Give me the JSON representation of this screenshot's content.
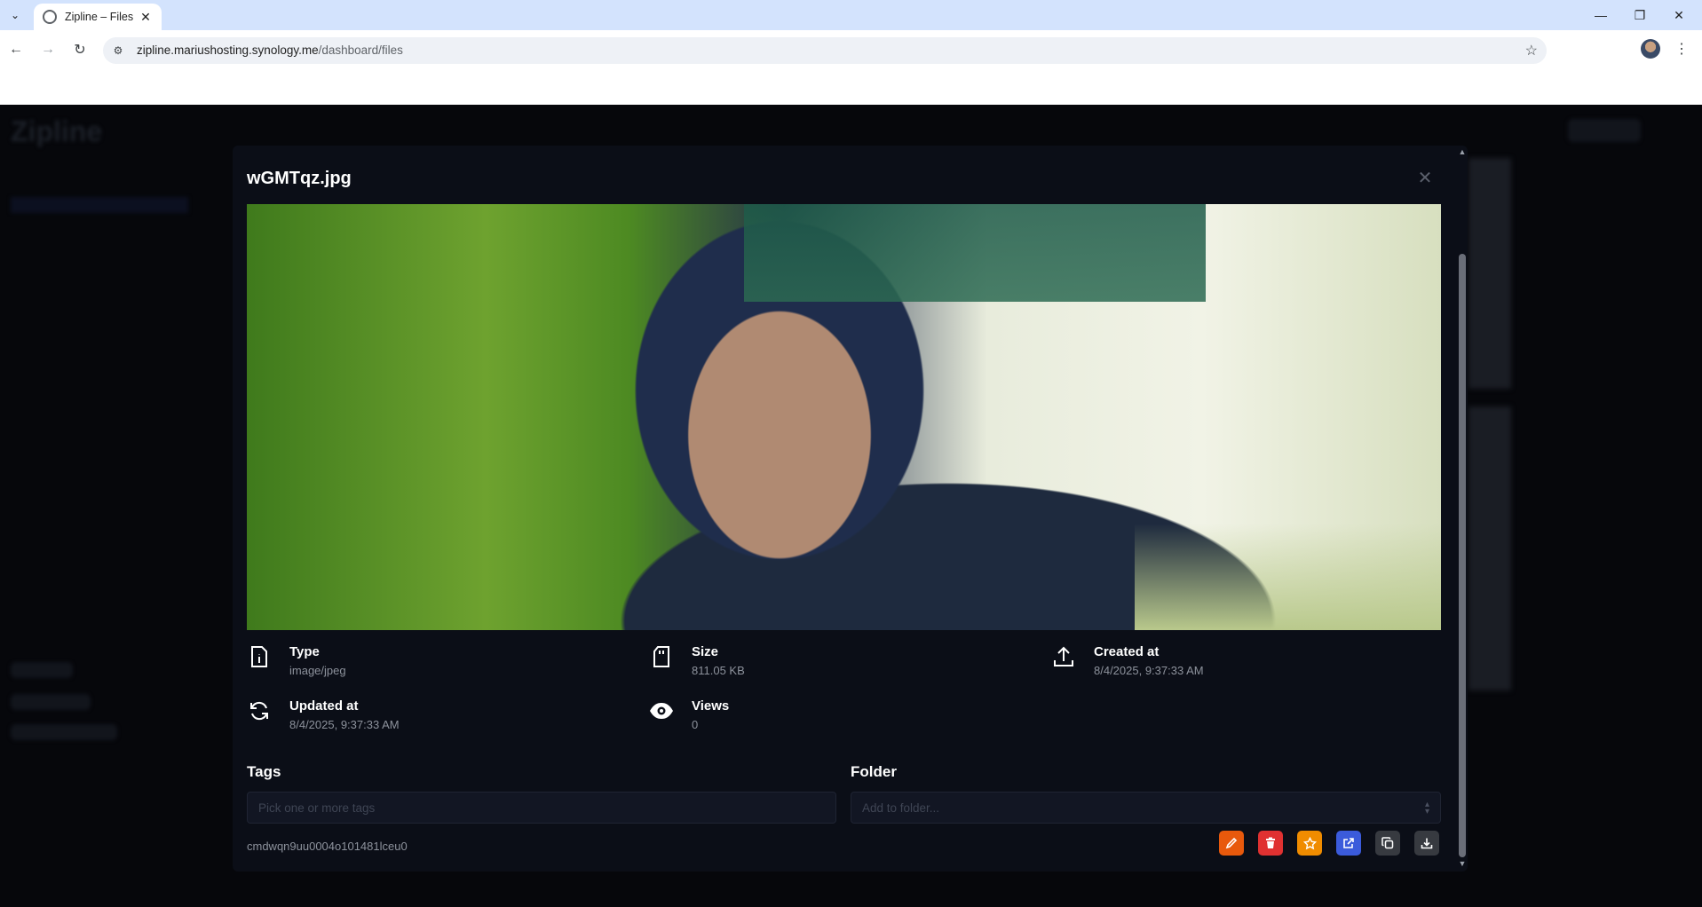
{
  "browser": {
    "tab_title": "Zipline – Files",
    "url_host": "zipline.mariushosting.synology.me",
    "url_path": "/dashboard/files"
  },
  "modal": {
    "title": "wGMTqz.jpg",
    "image_alt": "wGMTqz.jpg",
    "meta": {
      "type": {
        "label": "Type",
        "value": "image/jpeg"
      },
      "size": {
        "label": "Size",
        "value": "811.05 KB"
      },
      "created": {
        "label": "Created at",
        "value": "8/4/2025, 9:37:33 AM"
      },
      "updated": {
        "label": "Updated at",
        "value": "8/4/2025, 9:37:33 AM"
      },
      "views": {
        "label": "Views",
        "value": "0"
      }
    },
    "tags": {
      "label": "Tags",
      "placeholder": "Pick one or more tags"
    },
    "folder": {
      "label": "Folder",
      "placeholder": "Add to folder..."
    },
    "file_id": "cmdwqn9uu0004o101481lceu0",
    "actions": [
      {
        "icon": "pencil-icon",
        "color": "#e8590c"
      },
      {
        "icon": "trash-icon",
        "color": "#e03131"
      },
      {
        "icon": "star-icon",
        "color": "#f08c00"
      },
      {
        "icon": "external-link-icon",
        "color": "#3b5bdb"
      },
      {
        "icon": "copy-icon",
        "color": "#373a40"
      },
      {
        "icon": "download-icon",
        "color": "#373a40"
      }
    ]
  }
}
